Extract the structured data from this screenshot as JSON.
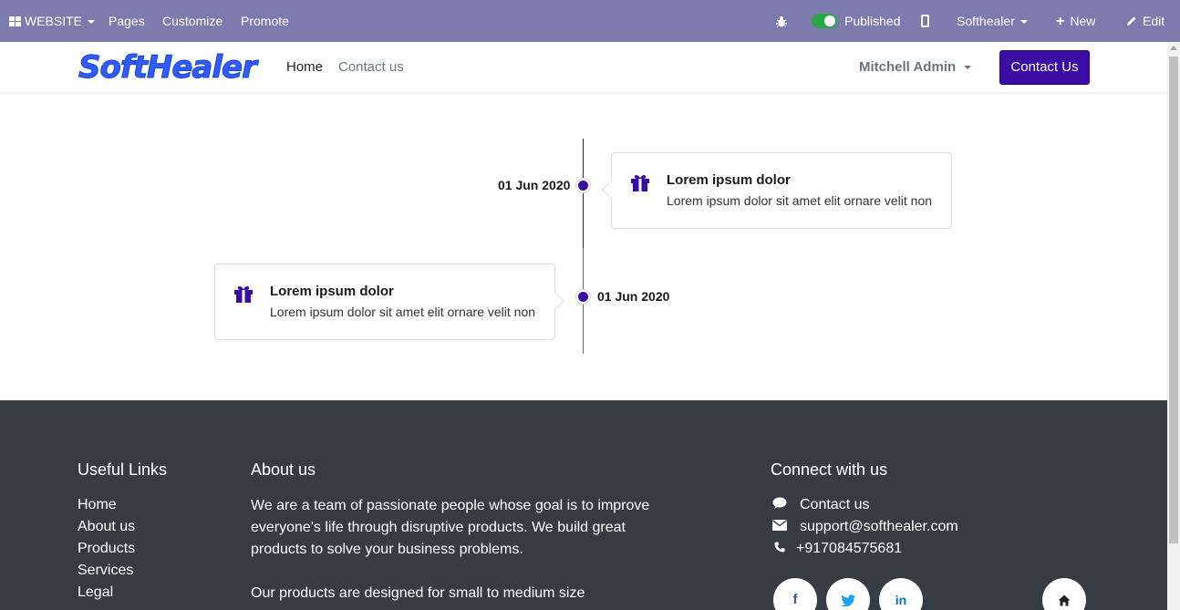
{
  "adminbar": {
    "website_label": "WEBSITE",
    "pages_label": "Pages",
    "customize_label": "Customize",
    "promote_label": "Promote",
    "published_label": "Published",
    "company_label": "Softhealer",
    "new_label": "New",
    "edit_label": "Edit"
  },
  "header": {
    "logo_text": "SoftHealer",
    "nav": [
      {
        "label": "Home",
        "active": true
      },
      {
        "label": "Contact us",
        "active": false
      }
    ],
    "user_label": "Mitchell Admin",
    "contact_button": "Contact Us"
  },
  "timeline": [
    {
      "date": "01 Jun 2020",
      "title": "Lorem ipsum dolor",
      "text": "Lorem ipsum dolor sit amet elit ornare velit non",
      "icon": "gift-icon",
      "side": "right"
    },
    {
      "date": "01 Jun 2020",
      "title": "Lorem ipsum dolor",
      "text": "Lorem ipsum dolor sit amet elit ornare velit non",
      "icon": "gift-icon",
      "side": "left"
    }
  ],
  "footer": {
    "useful_links_title": "Useful Links",
    "links": [
      "Home",
      "About us",
      "Products",
      "Services",
      "Legal"
    ],
    "about_title": "About us",
    "about_p1": "We are a team of passionate people whose goal is to improve everyone's life through disruptive products. We build great products to solve your business problems.",
    "about_p2": "Our products are designed for small to medium size",
    "connect_title": "Connect with us",
    "contact_label": "Contact us",
    "email": "support@softhealer.com",
    "phone": "+917084575681",
    "social": [
      "facebook-icon",
      "twitter-icon",
      "linkedin-icon",
      "home-icon"
    ]
  },
  "colors": {
    "adminbar": "#7c7bad",
    "accent": "#3a0ca3",
    "footer_bg": "#373b43",
    "logo": "#2f5bff"
  }
}
